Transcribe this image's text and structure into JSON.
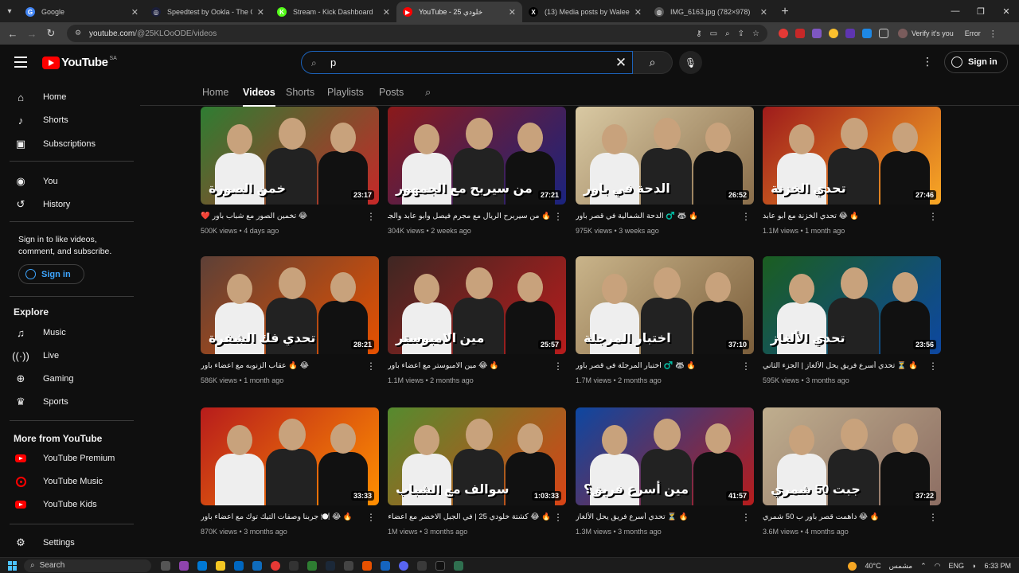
{
  "browser": {
    "tabs": [
      {
        "title": "Google",
        "fav_color": "#4285f4",
        "fav_glyph": "G"
      },
      {
        "title": "Speedtest by Ookla - The Globa",
        "fav_color": "#1b1e3a",
        "fav_glyph": "◎"
      },
      {
        "title": "Stream - Kick Dashboard",
        "fav_color": "#53fc18",
        "fav_glyph": "K"
      },
      {
        "title": "YouTube - 25 خلودي",
        "fav_color": "#ff0000",
        "fav_glyph": "▶",
        "active": true
      },
      {
        "title": "(13) Media posts by Waleed Al",
        "fav_color": "#000000",
        "fav_glyph": "X"
      },
      {
        "title": "IMG_6163.jpg (782×978)",
        "fav_color": "#555555",
        "fav_glyph": "◍"
      }
    ],
    "new_tab": "+",
    "url_host": "youtube.com",
    "url_path": "/@25KLOoODE/videos",
    "profile_label": "Verify it's you",
    "error_label": "Error"
  },
  "masthead": {
    "logo_text": "YouTube",
    "country": "SA",
    "search_value": "p",
    "search_placeholder": "Search",
    "signin_label": "Sign in"
  },
  "sidebar": {
    "main": [
      {
        "label": "Home",
        "icon": "home-icon"
      },
      {
        "label": "Shorts",
        "icon": "shorts-icon"
      },
      {
        "label": "Subscriptions",
        "icon": "subscriptions-icon"
      }
    ],
    "you": [
      {
        "label": "You",
        "icon": "you-icon"
      },
      {
        "label": "History",
        "icon": "history-icon"
      }
    ],
    "signin_note": "Sign in to like videos, comment, and subscribe.",
    "signin_label": "Sign in",
    "explore_title": "Explore",
    "explore": [
      {
        "label": "Music",
        "icon": "music-icon"
      },
      {
        "label": "Live",
        "icon": "live-icon"
      },
      {
        "label": "Gaming",
        "icon": "gaming-icon"
      },
      {
        "label": "Sports",
        "icon": "sports-icon"
      }
    ],
    "more_title": "More from YouTube",
    "more": [
      {
        "label": "YouTube Premium"
      },
      {
        "label": "YouTube Music"
      },
      {
        "label": "YouTube Kids"
      }
    ],
    "settings_label": "Settings"
  },
  "channel_tabs": [
    "Home",
    "Videos",
    "Shorts",
    "Playlists",
    "Posts"
  ],
  "active_tab": "Videos",
  "videos": [
    {
      "title": "😂 تخمين الصور مع شباب باور ❤️",
      "views": "500K views",
      "age": "4 days ago",
      "duration": "23:17",
      "overlay": "خمن الصورة",
      "bg": "#2e7d32",
      "bg2": "#c62828"
    },
    {
      "title": "🔥 من سيربرح الريال مع مجرم فيصل وأبو عابد والجمهور",
      "views": "304K views",
      "age": "2 weeks ago",
      "duration": "27:21",
      "overlay": "من سيربح مع الجمهور",
      "bg": "#8b1a1a",
      "bg2": "#1a237e"
    },
    {
      "title": "🔥 🦝 ♂️ الدحة الشمالية في قصر باور",
      "views": "975K views",
      "age": "3 weeks ago",
      "duration": "26:52",
      "overlay": "الدحة في باور",
      "bg": "#d9c9a3",
      "bg2": "#8a6e4b"
    },
    {
      "title": "🔥 😂 تحدي الخزنة مع أبو عابد",
      "views": "1.1M views",
      "age": "1 month ago",
      "duration": "27:46",
      "overlay": "تحدي الخزنة",
      "bg": "#9e1b1b",
      "bg2": "#f9a825"
    },
    {
      "title": "😂 🔥 عقاب الزنوبه مع اعضاء باور",
      "views": "586K views",
      "age": "1 month ago",
      "duration": "28:21",
      "overlay": "تحدي فك الشفرة",
      "bg": "#5d4037",
      "bg2": "#e65100"
    },
    {
      "title": "🔥 😂 مين الامبوستر مع اعضاء باور",
      "views": "1.1M views",
      "age": "2 months ago",
      "duration": "25:57",
      "overlay": "مين الامبوستر",
      "bg": "#3e2723",
      "bg2": "#b71c1c"
    },
    {
      "title": "🔥 🦝 ♂️ اختبار المرجلة في قصر باور",
      "views": "1.7M views",
      "age": "2 months ago",
      "duration": "37:10",
      "overlay": "اختبار المرجلة",
      "bg": "#c9b48a",
      "bg2": "#7b5e3b"
    },
    {
      "title": "🔥 ⏳ تحدي أسرع فريق يحل الألغاز | الجزء الثاني",
      "views": "595K views",
      "age": "3 months ago",
      "duration": "23:56",
      "overlay": "تحدي الألغاز",
      "bg": "#1b5e20",
      "bg2": "#0d47a1"
    },
    {
      "title": "🔥 😂 🍽️ جربنا وصفات التيك توك مع اعضاء باور",
      "views": "870K views",
      "age": "3 months ago",
      "duration": "33:33",
      "overlay": "",
      "bg": "#b71c1c",
      "bg2": "#ff8f00"
    },
    {
      "title": "🔥 😂 كشتة خلودي 25 | في الجبل الاخضر مع اعضاء باور",
      "views": "1M views",
      "age": "3 months ago",
      "duration": "1:03:33",
      "overlay": "سوالف مع الشباب",
      "bg": "#558b2f",
      "bg2": "#d84315"
    },
    {
      "title": "🔥 ⏳ تحدي أسرع فريق يحل الألغاز",
      "views": "1.3M views",
      "age": "3 months ago",
      "duration": "41:57",
      "overlay": "مين أسرع فريق؟",
      "bg": "#0d47a1",
      "bg2": "#b71c1c"
    },
    {
      "title": "🔥 😂 داهمت قصر باور ب 50 شمري",
      "views": "3.6M views",
      "age": "4 months ago",
      "duration": "37:22",
      "overlay": "جبت 50 شمري",
      "bg": "#bfae8e",
      "bg2": "#8d6e63"
    }
  ],
  "taskbar": {
    "search_label": "Search",
    "temperature": "40°C",
    "weather_text": "مشمس",
    "lang": "ENG",
    "time": "6:33 PM"
  }
}
